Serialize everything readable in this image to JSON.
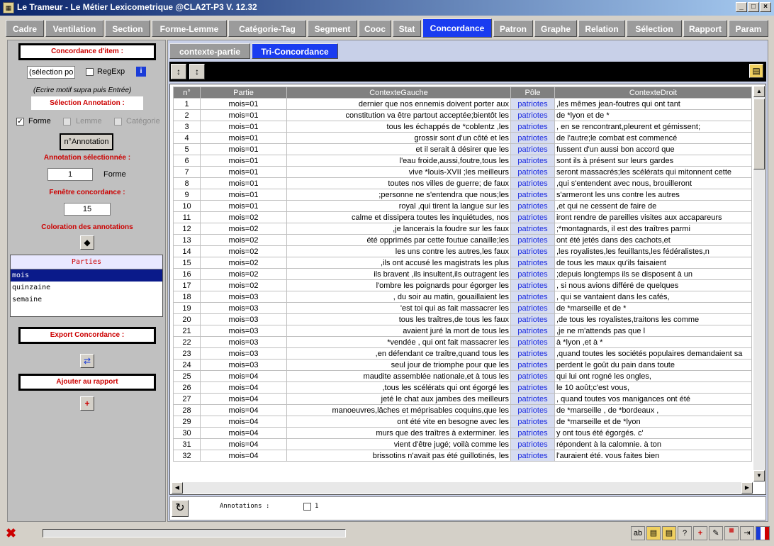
{
  "window": {
    "title": "Le Trameur - Le Métier Lexicometrique @CLA2T-P3 V. 12.32"
  },
  "tabs": [
    "Cadre",
    "Ventilation",
    "Section",
    "Forme-Lemme",
    "Catégorie-Tag",
    "Segment",
    "Cooc",
    "Stat",
    "Concordance",
    "Patron",
    "Graphe",
    "Relation",
    "Sélection",
    "Rapport",
    "Param"
  ],
  "left": {
    "concordance_item_label": "Concordance d'item :",
    "search_value": "(sélection po",
    "regexp_label": "RegExp",
    "hint": "(Ecrire motif supra puis Entrée)",
    "selection_annotation_label": "Sélection Annotation :",
    "forme_label": "Forme",
    "lemme_label": "Lemme",
    "categorie_label": "Catégorie",
    "n_annotation_button": "n°Annotation",
    "annotation_selected_label": "Annotation sélectionnée :",
    "annotation_value": "1",
    "annotation_type": "Forme",
    "window_label": "Fenêtre concordance :",
    "window_value": "15",
    "coloration_label": "Coloration des annotations",
    "parties_header": "Parties",
    "parties": [
      "mois",
      "quinzaine",
      "semaine"
    ],
    "export_label": "Export Concordance :",
    "report_label": "Ajouter au rapport"
  },
  "main": {
    "subtabs": [
      "contexte-partie",
      "Tri-Concordance"
    ],
    "columns": [
      "n°",
      "Partie",
      "ContexteGauche",
      "Pôle",
      "ContexteDroit"
    ],
    "rows": [
      [
        "1",
        "mois=01",
        "dernier que nos ennemis doivent porter aux",
        "patriotes",
        ",les mêmes jean-foutres qui ont tant"
      ],
      [
        "2",
        "mois=01",
        "constitution va être partout acceptée;bientôt les",
        "patriotes",
        "de *lyon et de *"
      ],
      [
        "3",
        "mois=01",
        "tous les échappés de *coblentz ,les",
        "patriotes",
        ", en se rencontrant,pleurent et gémissent;"
      ],
      [
        "4",
        "mois=01",
        "grossir sont d'un côté et les",
        "patriotes",
        "de l'autre;le combat est commencé"
      ],
      [
        "5",
        "mois=01",
        "et il serait à désirer que les",
        "patriotes",
        "fussent d'un aussi bon accord que"
      ],
      [
        "6",
        "mois=01",
        "l'eau froide,aussi,foutre,tous les",
        "patriotes",
        "sont ils à présent sur leurs gardes"
      ],
      [
        "7",
        "mois=01",
        "vive *louis-XVII ;les meilleurs",
        "patriotes",
        "seront massacrés;les scélérats qui mitonnent cette"
      ],
      [
        "8",
        "mois=01",
        "toutes nos villes de guerre; de faux",
        "patriotes",
        ",qui s'entendent avec nous, brouilleront"
      ],
      [
        "9",
        "mois=01",
        ";personne ne s'entendra que nous;les",
        "patriotes",
        "s'armeront les uns contre les autres"
      ],
      [
        "10",
        "mois=01",
        "royal ,qui tirent la langue sur les",
        "patriotes",
        ",et qui ne cessent de faire de"
      ],
      [
        "11",
        "mois=02",
        "calme et dissipera toutes les inquiétudes, nos",
        "patriotes",
        "iront rendre de pareilles visites aux accapareurs"
      ],
      [
        "12",
        "mois=02",
        ",je lancerais la foudre sur les faux",
        "patriotes",
        ";*montagnards, il est des traîtres parmi"
      ],
      [
        "13",
        "mois=02",
        "été opprimés par cette foutue canaille;les",
        "patriotes",
        "ont été jetés dans des cachots,et"
      ],
      [
        "14",
        "mois=02",
        "les uns contre les autres,les faux",
        "patriotes",
        ",les royalistes,les feuillants,les fédéralistes,n"
      ],
      [
        "15",
        "mois=02",
        ",ils ont accusé les magistrats les plus",
        "patriotes",
        "de tous les maux qu'ils faisaient"
      ],
      [
        "16",
        "mois=02",
        "ils bravent ,ils insultent,ils outragent les",
        "patriotes",
        ";depuis longtemps ils se disposent à un"
      ],
      [
        "17",
        "mois=02",
        "l'ombre les poignards pour égorger les",
        "patriotes",
        ", si nous avions différé de quelques"
      ],
      [
        "18",
        "mois=03",
        ", du soir au matin, gouaillaient les",
        "patriotes",
        ", qui se vantaient dans les cafés,"
      ],
      [
        "19",
        "mois=03",
        "'est toi qui as fait massacrer les",
        "patriotes",
        "de *marseille et de *"
      ],
      [
        "20",
        "mois=03",
        "tous les traîtres,de tous les faux",
        "patriotes",
        ",de tous les royalistes,traitons les comme"
      ],
      [
        "21",
        "mois=03",
        "avaient juré la mort de tous les",
        "patriotes",
        ",je ne m'attends pas que l"
      ],
      [
        "22",
        "mois=03",
        "*vendée , qui ont fait massacrer les",
        "patriotes",
        "à *lyon ,et à *"
      ],
      [
        "23",
        "mois=03",
        ",en défendant ce traître,quand tous les",
        "patriotes",
        ",quand toutes les sociétés populaires demandaient sa"
      ],
      [
        "24",
        "mois=03",
        "seul jour de triomphe pour que les",
        "patriotes",
        "perdent le goût du pain dans toute"
      ],
      [
        "25",
        "mois=04",
        "maudite assemblée nationale,et à tous les",
        "patriotes",
        "qui lui ont rogné les ongles,"
      ],
      [
        "26",
        "mois=04",
        ",tous les scélérats qui ont égorgé les",
        "patriotes",
        "le 10 août;c'est vous,"
      ],
      [
        "27",
        "mois=04",
        "jeté le chat aux jambes des meilleurs",
        "patriotes",
        ", quand toutes vos manigances ont été"
      ],
      [
        "28",
        "mois=04",
        "manoeuvres,lâches et méprisables coquins,que les",
        "patriotes",
        "de *marseille , de *bordeaux ,"
      ],
      [
        "29",
        "mois=04",
        "ont été vite en besogne avec les",
        "patriotes",
        "de *marseille et de *lyon"
      ],
      [
        "30",
        "mois=04",
        "murs que des traîtres à exterminer. les",
        "patriotes",
        "y ont tous été égorgés. c'"
      ],
      [
        "31",
        "mois=04",
        "vient d'être jugé; voilà comme les",
        "patriotes",
        "répondent à la calomnie. à ton"
      ],
      [
        "32",
        "mois=04",
        "brissotins n'avait pas été guillotinés, les",
        "patriotes",
        "l'auraient été. vous faites bien"
      ]
    ],
    "annotations_label": "Annotations :",
    "annotations_value": "1"
  }
}
